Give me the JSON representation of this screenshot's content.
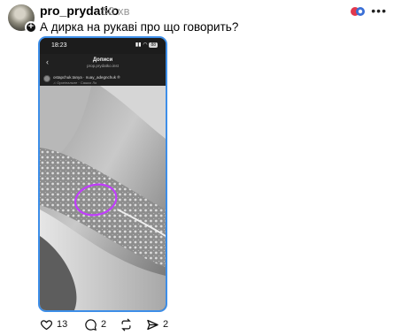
{
  "post": {
    "username": "pro_prydatko",
    "timestamp": "50 хв",
    "text": "А дирка на рукаві про що говорить?",
    "avatar_icon": "avatar-photo",
    "add_icon": "plus-icon",
    "more_icon": "more-icon"
  },
  "embedded_screenshot": {
    "status_time": "18:23",
    "status_battery": "88",
    "header_title": "Допиcи",
    "header_subtitle": "prop.prydatko.inst",
    "ig_username": "ostapchuk.tanya · nuay_adegnchuk ®",
    "ig_audio": "♫ Оригінальне · Сашко Ло"
  },
  "actions": {
    "likes": "13",
    "comments": "2",
    "reposts": "",
    "shares": "2"
  },
  "colors": {
    "accent_border": "#3d8ee8",
    "annotation_circle": "#c23cff",
    "timestamp": "#9b9b9b"
  }
}
